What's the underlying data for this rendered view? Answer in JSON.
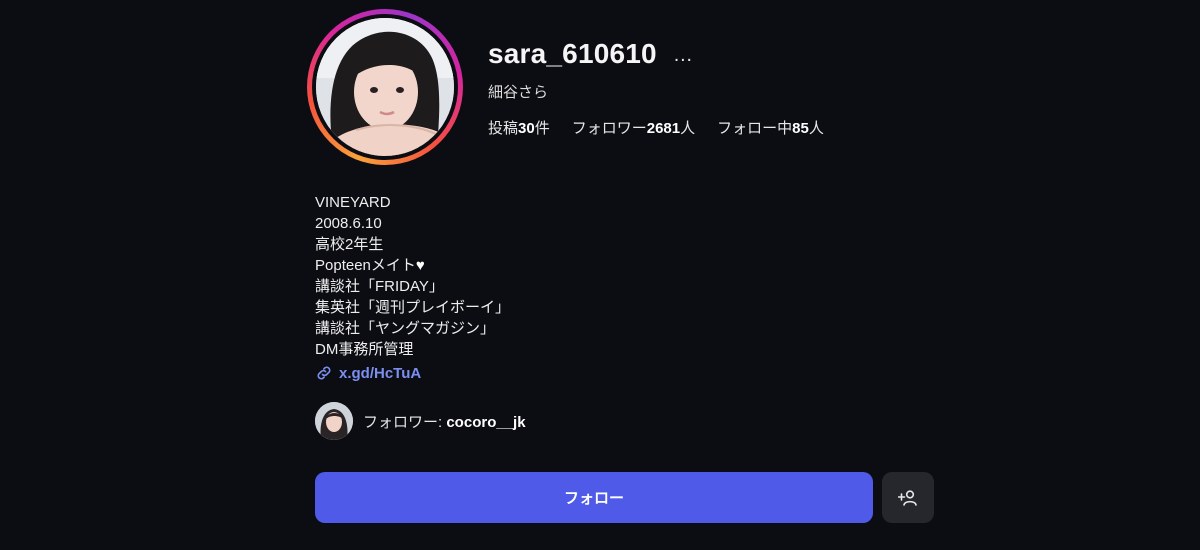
{
  "profile": {
    "username": "sara_610610",
    "full_name": "細谷さら",
    "avatar_icon": "profile-photo",
    "story_ring_colors": [
      "#f9a23a",
      "#f5503e",
      "#d6249f",
      "#9b36c9"
    ]
  },
  "header": {
    "more_icon": "…"
  },
  "stats": [
    {
      "prefix": "投稿",
      "value": "30",
      "suffix": "件"
    },
    {
      "prefix": "フォロワー",
      "value": "2681",
      "suffix": "人"
    },
    {
      "prefix": "フォロー中",
      "value": "85",
      "suffix": "人"
    }
  ],
  "bio": {
    "lines": [
      "VINEYARD",
      "2008.6.10",
      "高校2年生",
      "Popteenメイト",
      "講談社「FRIDAY」",
      "集英社「週刊プレイボーイ」",
      "講談社「ヤングマガジン」",
      "DM事務所管理"
    ],
    "heart_symbol": "🤍",
    "link_text": "x.gd/HcTuA",
    "link_icon": "link-icon"
  },
  "followed_by": {
    "label": "フォロワー: ",
    "name": "cocoro__jk"
  },
  "actions": {
    "follow_label": "フォロー",
    "suggest_icon": "add-person-icon"
  },
  "colors": {
    "background": "#0c0d12",
    "accent": "#4f5be8",
    "link": "#7b8ff0"
  }
}
